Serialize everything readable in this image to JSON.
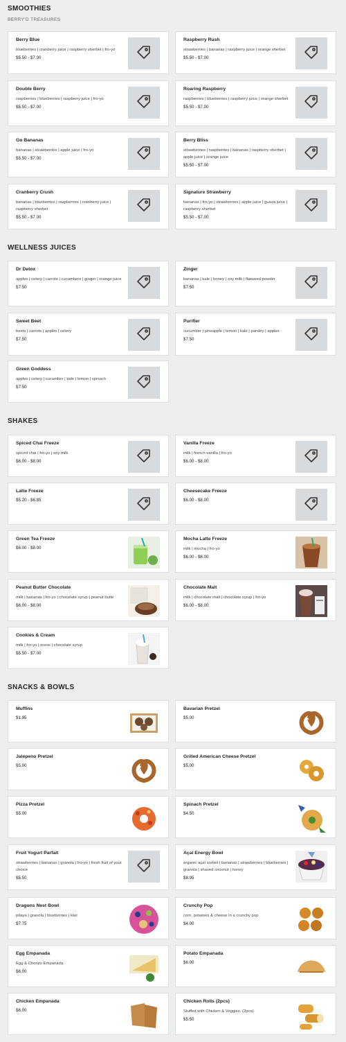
{
  "sections": {
    "smoothies": {
      "title": "SMOOTHIES",
      "subtitle": "BERRY'D TREASURES"
    },
    "wellness": {
      "title": "WELLNESS JUICES"
    },
    "shakes": {
      "title": "SHAKES"
    },
    "snacks": {
      "title": "SNACKS & BOWLS"
    }
  },
  "items": [
    {
      "name": "Berry Blue",
      "desc": "blueberries | cranberry juice | raspberry sherbet | fro-yo",
      "price": "$5.50 - $7.00",
      "icon": "tag-icon"
    },
    {
      "name": "Raspberry Rush",
      "desc": "strawberries | bananas | raspberry juice | orange sherbet",
      "price": "$5.50 - $7.00",
      "icon": "tag-icon"
    },
    {
      "name": "Double Berry",
      "desc": "raspberries | blueberries | raspberry juice | fro-yo",
      "price": "$5.50 - $7.00",
      "icon": "tag-icon"
    },
    {
      "name": "Roaring Raspberry",
      "desc": "raspberries | blueberries | raspberry juice | orange sherbet",
      "price": "$5.50 - $7.00",
      "icon": "tag-icon"
    },
    {
      "name": "Go Bananas",
      "desc": "bananas | strawberries | apple juice | fro-yo",
      "price": "$5.50 - $7.00",
      "icon": "tag-icon"
    },
    {
      "name": "Berry Bliss",
      "desc": "strawberries | raspberries | bananas | raspberry sherbet | apple juice | orange juice",
      "price": "$5.50 - $7.00",
      "icon": "tag-icon"
    },
    {
      "name": "Cranberry Crush",
      "desc": "bananas | blueberries | raspberries | cranberry juice | raspberry sherbet",
      "price": "$5.50 - $7.00",
      "icon": "tag-icon"
    },
    {
      "name": "Signature Strawberry",
      "desc": "bananas | fro-yo | strawberries | apple juice | guava juice | raspberry sherbet",
      "price": "$5.50 - $7.00",
      "icon": "tag-icon"
    },
    {
      "name": "Dr Detox",
      "desc": "apples | celery | carrots | cucumbers | ginger | orange juice",
      "price": "$7.50",
      "icon": "tag-icon"
    },
    {
      "name": "Zinger",
      "desc": "bananas | kale | honey | soy milk | flaxseed powder",
      "price": "$7.50",
      "icon": "tag-icon"
    },
    {
      "name": "Sweet Beet",
      "desc": "beets | carrots | apples | celery",
      "price": "$7.50",
      "icon": "tag-icon"
    },
    {
      "name": "Purifier",
      "desc": "cucumber | pineapple | lemon | kale | parsley | apples",
      "price": "$7.50",
      "icon": "tag-icon"
    },
    {
      "name": "Green Goddess",
      "desc": "apples | celery | cucumber | kale | lemon | spinach",
      "price": "$7.50",
      "icon": "tag-icon"
    },
    {
      "name": "Spiced Chai Freeze",
      "desc": "spiced chai | fro-yo | soy milk",
      "price": "$6.00 - $8.00",
      "icon": "tag-icon"
    },
    {
      "name": "Vanilla Freeze",
      "desc": "milk | french vanilla | fro-yo",
      "price": "$6.00 - $8.00",
      "icon": "tag-icon"
    },
    {
      "name": "Latte Freeze",
      "desc": "",
      "price": "$5.20 - $6.85",
      "icon": "tag-icon"
    },
    {
      "name": "Cheesecake Freeze",
      "desc": "",
      "price": "$6.00 - $8.00",
      "icon": "tag-icon"
    },
    {
      "name": "Green Tea Freeze",
      "desc": "",
      "price": "$6.00 - $8.00",
      "photo": "green-tea-photo"
    },
    {
      "name": "Mocha Latte Freeze",
      "desc": "milk | mocha | fro-yo",
      "price": "$6.00 - $8.00",
      "photo": "mocha-photo"
    },
    {
      "name": "Peanut Butter Chocolate",
      "desc": "milk | bananas | fro-yo | chocolate syrup | peanut butte",
      "price": "$6.00 - $8.00",
      "photo": "pb-choc-photo"
    },
    {
      "name": "Chocolate Malt",
      "desc": "milk | chocolate malt | chocolate syrup | fro-yo",
      "price": "$6.00 - $8.00",
      "photo": "choc-malt-photo"
    },
    {
      "name": "Cookies & Cream",
      "desc": "milk | fro-yo | oreos | chocolate syrup",
      "price": "$5.50 - $7.00",
      "photo": "cookies-cream-photo"
    },
    {
      "name": "Muffins",
      "desc": "",
      "price": "$1.95",
      "photo": "muffins-photo"
    },
    {
      "name": "Bavarian Pretzel",
      "desc": "",
      "price": "$5.00",
      "photo": "pretzel-photo"
    },
    {
      "name": "Jalepeno Pretzel",
      "desc": "",
      "price": "$5.00",
      "photo": "pretzel-photo"
    },
    {
      "name": "Grilled American Cheese Pretzel",
      "desc": "",
      "price": "$5.00",
      "photo": "cheese-pretzel-photo"
    },
    {
      "name": "Pizza Pretzel",
      "desc": "",
      "price": "$5.00",
      "photo": "pizza-pretzel-photo"
    },
    {
      "name": "Spinach Pretzel",
      "desc": "",
      "price": "$4.50",
      "photo": "spinach-pretzel-photo"
    },
    {
      "name": "Fruit Yogurt Parfait",
      "desc": "strawberries | bananas | granola | fro-yo | fresh fruit of your choice",
      "price": "$5.50",
      "icon": "tag-icon"
    },
    {
      "name": "Açaí Energy Bowl",
      "desc": "organic açaí sorbet | bananas | strawberries | blueberries | granola | shaved coconut | honey",
      "price": "$8.95",
      "photo": "acai-photo"
    },
    {
      "name": "Dragons Nest Bowl",
      "desc": "pitaya | granola | blueberries | kiwi",
      "price": "$7.75",
      "photo": "dragon-bowl-photo"
    },
    {
      "name": "Crunchy Pop",
      "desc": "corn, potatoes & cheese in a crunchy pop",
      "price": "$4.00",
      "photo": "crunchy-pop-photo"
    },
    {
      "name": "Egg Empanada",
      "desc": "Egg & Chorizo Empanada",
      "price": "$6.00",
      "photo": "egg-empanada-photo"
    },
    {
      "name": "Potato Empanada",
      "desc": "",
      "price": "$6.00",
      "photo": "potato-empanada-photo"
    },
    {
      "name": "Chicken Empanada",
      "desc": "",
      "price": "$6.00",
      "photo": "chicken-empanada-photo"
    },
    {
      "name": "Chicken Rolls (2pcs)",
      "desc": "Stuffed with Chicken & Veggies. (2pcs)",
      "price": "$5.50",
      "photo": "chicken-rolls-photo"
    }
  ]
}
